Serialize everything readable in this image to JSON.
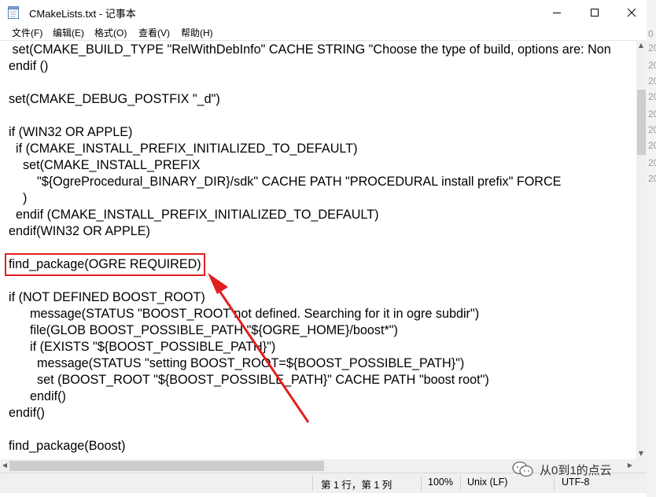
{
  "window": {
    "title": "CMakeLists.txt - 记事本"
  },
  "menu": [
    {
      "label": "文件(F)"
    },
    {
      "label": "编辑(E)"
    },
    {
      "label": "格式(O)"
    },
    {
      "label": "查看(V)"
    },
    {
      "label": "帮助(H)"
    }
  ],
  "editor": {
    "lines": [
      " set(CMAKE_BUILD_TYPE \"RelWithDebInfo\" CACHE STRING \"Choose the type of build, options are: Non",
      "endif ()",
      "",
      "set(CMAKE_DEBUG_POSTFIX \"_d\")",
      "",
      "if (WIN32 OR APPLE)",
      "  if (CMAKE_INSTALL_PREFIX_INITIALIZED_TO_DEFAULT)",
      "    set(CMAKE_INSTALL_PREFIX",
      "\t\t\"${OgreProcedural_BINARY_DIR}/sdk\" CACHE PATH \"PROCEDURAL install prefix\" FORCE",
      "    )",
      "  endif (CMAKE_INSTALL_PREFIX_INITIALIZED_TO_DEFAULT)",
      "endif(WIN32 OR APPLE)",
      "",
      "find_package(OGRE REQUIRED)",
      "",
      "if (NOT DEFINED BOOST_ROOT)",
      "\t\tmessage(STATUS \"BOOST_ROOT not defined. Searching for it in ogre subdir\")",
      "\t\tfile(GLOB BOOST_POSSIBLE_PATH \"${OGRE_HOME}/boost*\")",
      "\t\tif (EXISTS \"${BOOST_POSSIBLE_PATH}\")",
      "\t\t\t\tmessage(STATUS \"setting BOOST_ROOT=${BOOST_POSSIBLE_PATH}\")",
      "\t\t\t\tset (BOOST_ROOT \"${BOOST_POSSIBLE_PATH}\" CACHE PATH \"boost root\")",
      "\t\tendif()",
      "endif()",
      "",
      "find_package(Boost)"
    ]
  },
  "status": {
    "position": "第 1 行，第 1 列",
    "zoom": "100%",
    "line_ending": "Unix (LF)",
    "encoding": "UTF-8"
  },
  "watermark": {
    "text": "从0到1的点云"
  },
  "background_strip": [
    "0",
    "20",
    "20",
    "20",
    "20",
    "20",
    "20",
    "20",
    "20",
    "20"
  ],
  "colors": {
    "annotation": "#e02020",
    "scrollbar": "#f0f0f0",
    "thumb": "#cdcdcd"
  }
}
